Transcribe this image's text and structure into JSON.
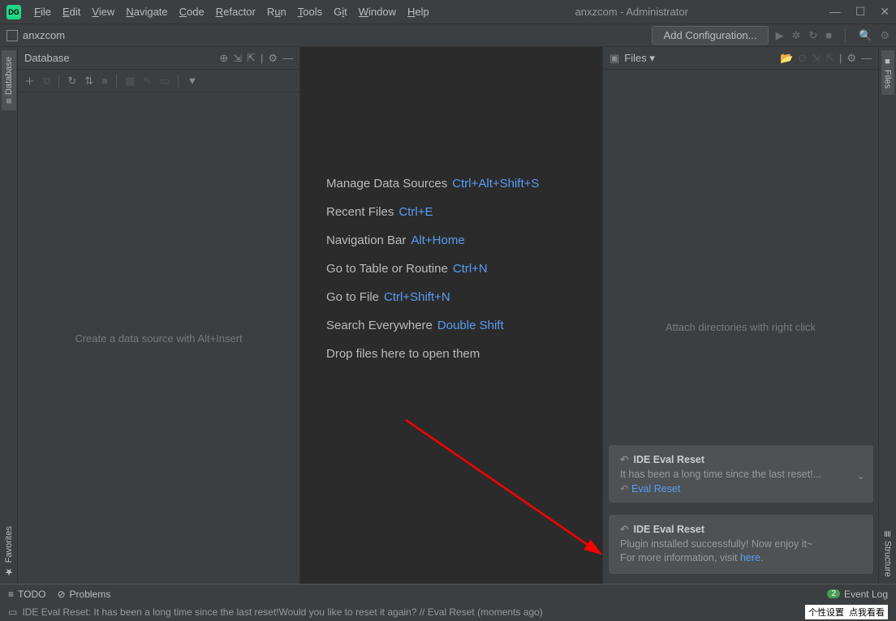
{
  "title": "anxzcom - Administrator",
  "menus": [
    "File",
    "Edit",
    "View",
    "Navigate",
    "Code",
    "Refactor",
    "Run",
    "Tools",
    "Git",
    "Window",
    "Help"
  ],
  "breadcrumb": "anxzcom",
  "addConfig": "Add Configuration...",
  "leftTabs": {
    "database": "Database",
    "favorites": "Favorites"
  },
  "rightTabs": {
    "files": "Files",
    "structure": "Structure"
  },
  "dbPanel": {
    "title": "Database",
    "emptyHint": "Create a data source with Alt+Insert"
  },
  "filesPanel": {
    "title": "Files",
    "emptyHint": "Attach directories with right click"
  },
  "hints": [
    {
      "label": "Manage Data Sources",
      "key": "Ctrl+Alt+Shift+S"
    },
    {
      "label": "Recent Files",
      "key": "Ctrl+E"
    },
    {
      "label": "Navigation Bar",
      "key": "Alt+Home"
    },
    {
      "label": "Go to Table or Routine",
      "key": "Ctrl+N"
    },
    {
      "label": "Go to File",
      "key": "Ctrl+Shift+N"
    },
    {
      "label": "Search Everywhere",
      "key": "Double Shift"
    },
    {
      "label": "Drop files here to open them",
      "key": ""
    }
  ],
  "notif1": {
    "title": "IDE Eval Reset",
    "line": "It has been a long time since the last reset!...",
    "action": "Eval Reset"
  },
  "notif2": {
    "title": "IDE Eval Reset",
    "line1": "Plugin installed successfully! Now enjoy it~",
    "line2a": "For more information, visit ",
    "line2b": "here"
  },
  "status": {
    "todo": "TODO",
    "problems": "Problems",
    "eventlog": "Event Log",
    "badge": "2"
  },
  "statusLine": "IDE Eval Reset: It has been a long time since the last reset!Would you like to reset it again? // Eval Reset (moments ago)",
  "cnText": [
    "个性设置",
    "点我看看"
  ]
}
